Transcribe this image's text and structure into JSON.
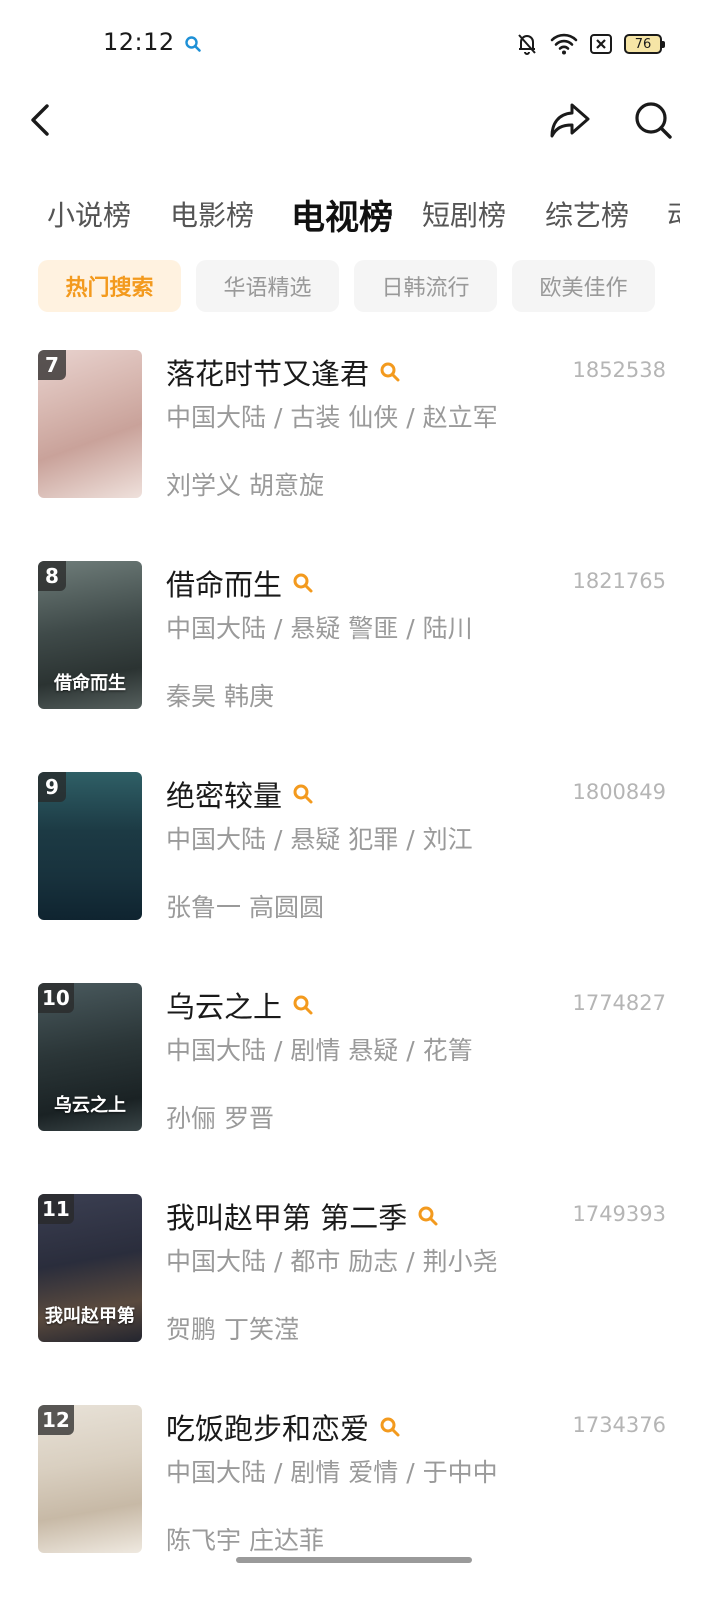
{
  "status_bar": {
    "time": "12:12",
    "battery": "76",
    "icons": [
      "search-icon",
      "bell-off-icon",
      "wifi-icon",
      "sim-off-icon",
      "battery-icon"
    ]
  },
  "header": {
    "icons": [
      "back-arrow-icon",
      "share-icon",
      "search-icon"
    ]
  },
  "category_tabs": [
    "小说榜",
    "电影榜",
    "电视榜",
    "短剧榜",
    "综艺榜",
    "动"
  ],
  "active_category": "电视榜",
  "filter_chips": [
    "热门搜索",
    "华语精选",
    "日韩流行",
    "欧美佳作"
  ],
  "active_filter": "热门搜索",
  "colors": {
    "accent": "#f39a1e",
    "accent_bg": "#fff2e0",
    "muted_text": "#9a9a9a"
  },
  "items": [
    {
      "rank": "7",
      "title": "落花时节又逢君",
      "count": "1852538",
      "meta": "中国大陆 / 古装 仙侠 / 赵立军",
      "cast": "刘学义 胡意旋",
      "poster_text": ""
    },
    {
      "rank": "8",
      "title": "借命而生",
      "count": "1821765",
      "meta": "中国大陆 / 悬疑 警匪 / 陆川",
      "cast": "秦昊 韩庚",
      "poster_text": "借命而生"
    },
    {
      "rank": "9",
      "title": "绝密较量",
      "count": "1800849",
      "meta": "中国大陆 / 悬疑 犯罪 / 刘江",
      "cast": "张鲁一 高圆圆",
      "poster_text": ""
    },
    {
      "rank": "10",
      "title": "乌云之上",
      "count": "1774827",
      "meta": "中国大陆 / 剧情 悬疑 / 花箐",
      "cast": "孙俪 罗晋",
      "poster_text": "乌云之上"
    },
    {
      "rank": "11",
      "title": "我叫赵甲第 第二季",
      "count": "1749393",
      "meta": "中国大陆 / 都市 励志 / 荆小尧",
      "cast": "贺鹏 丁笑滢",
      "poster_text": "我叫赵甲第"
    },
    {
      "rank": "12",
      "title": "吃饭跑步和恋爱",
      "count": "1734376",
      "meta": "中国大陆 / 剧情 爱情 / 于中中",
      "cast": "陈飞宇 庄达菲",
      "poster_text": ""
    }
  ]
}
